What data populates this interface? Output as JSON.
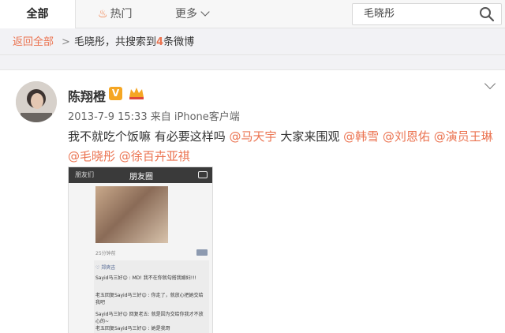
{
  "nav": {
    "tab_all": "全部",
    "tab_hot": "热门",
    "tab_more": "更多",
    "search_value": "毛晓彤"
  },
  "breadcrumb": {
    "back": "返回全部",
    "separator": ">",
    "prefix": "毛晓彤，共搜索到",
    "count": "4",
    "suffix": "条微博"
  },
  "post": {
    "username": "陈翔橙",
    "vip_badge": "V",
    "timestamp": "2013-7-9 15:33",
    "source": "来自 iPhone客户端",
    "text_1": "我不就吃个饭嘛 有必要这样吗 ",
    "mention_1": "@马天宇",
    "text_2": "  大家来围观 ",
    "mention_2": "@韩雪",
    "mention_3": "@刘恩佑",
    "mention_4": "@演员王琳",
    "mention_5": "@毛晓彤",
    "mention_6": "@徐百卉亚祺"
  },
  "screenshot": {
    "back": "朋友们",
    "title": "朋友圈",
    "time": "25分钟前",
    "like": "♡ 郑爽吉",
    "comment_1": "Sayid马三好😊 : MD! 我不在你就勾搭我媳妇!!!",
    "comment_2": "老五回复Sayid马三好😊 : 你走了，就放心把她交给我吧",
    "comment_3": "Sayid马三好😊 回复老五: 就是因为交给你我才不放心的~",
    "comment_4": "老五回复Sayid马三好😊 : 她是我哥"
  },
  "colors": {
    "accent": "#eb7350",
    "link": "#eb7350",
    "badge": "#f5a623"
  },
  "icons": {
    "hot": "flame-icon",
    "more": "chevron-down-icon",
    "search": "search-icon",
    "menu": "chevron-down-icon",
    "camera": "camera-icon"
  }
}
